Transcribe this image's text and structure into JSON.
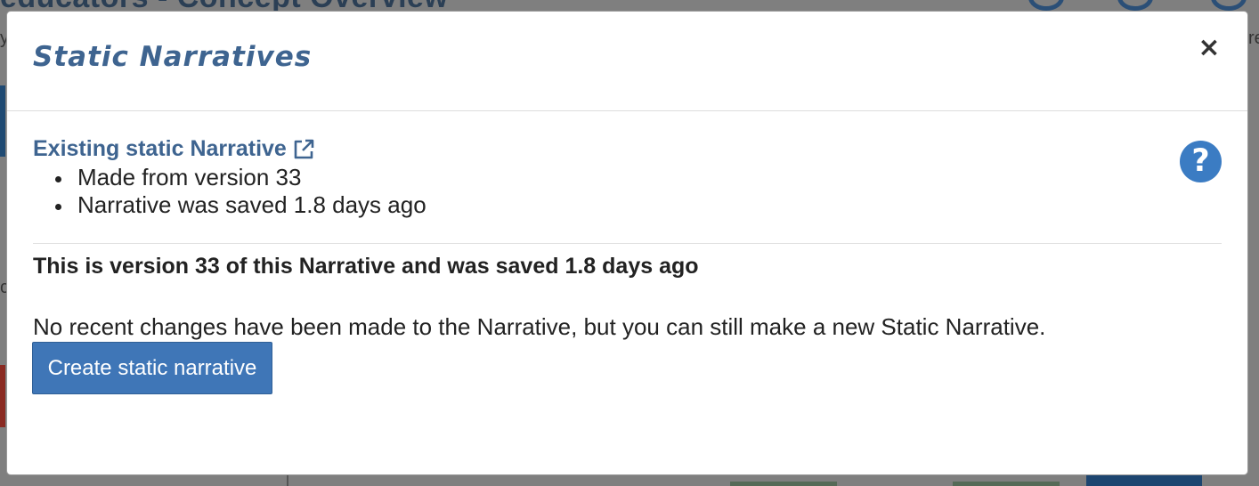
{
  "background": {
    "title_fragment": "educators - Concept Overview",
    "left_letter_1": "y",
    "left_letter_2": "c",
    "right_fragment": "re"
  },
  "modal": {
    "title": "Static Narratives",
    "close_label": "×",
    "existing": {
      "link_label": "Existing static Narrative",
      "bullets": [
        "Made from version 33",
        "Narrative was saved 1.8 days ago"
      ]
    },
    "help_label": "?",
    "version_line": "This is version 33 of this Narrative and was saved 1.8 days ago",
    "info_line": "No recent changes have been made to the Narrative, but you can still make a new Static Narrative.",
    "create_button": "Create static narrative"
  },
  "colors": {
    "accent": "#3e6490",
    "button": "#3f76b7",
    "help_icon": "#3b7cc3"
  },
  "icons": {
    "close": "close-icon",
    "external_link": "external-link-icon",
    "help": "question-circle-icon"
  }
}
